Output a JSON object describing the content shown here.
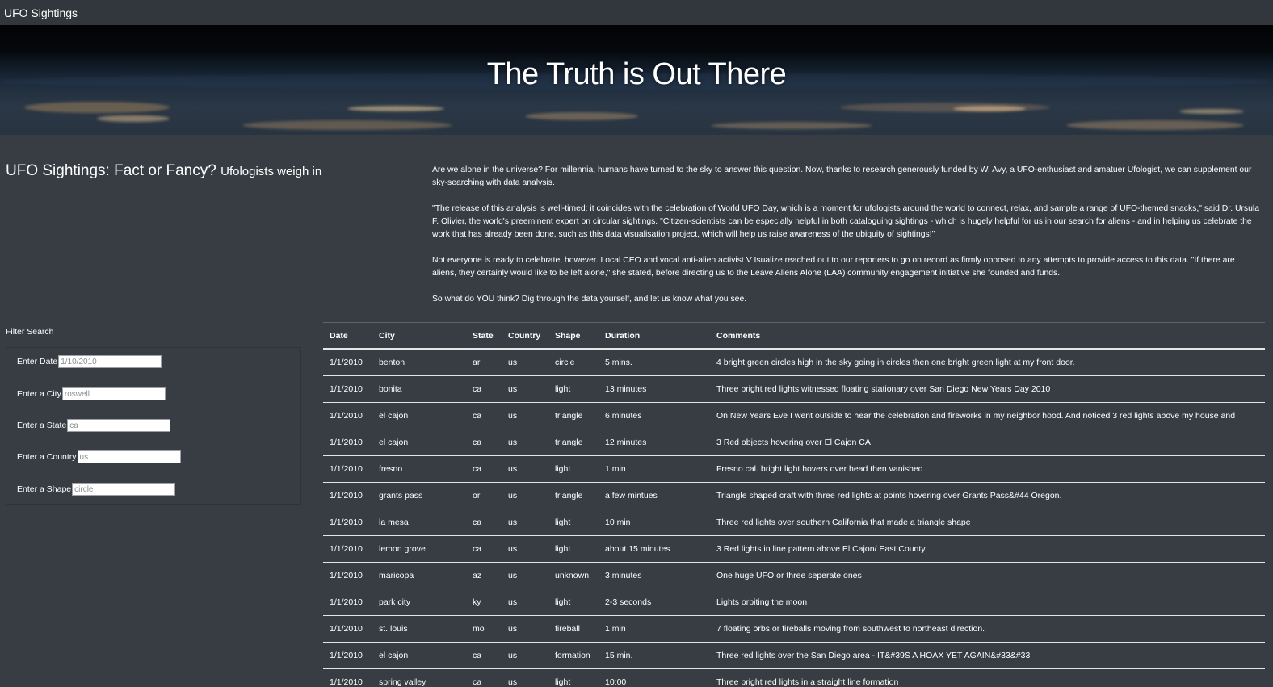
{
  "navbar": {
    "brand": "UFO Sightings"
  },
  "hero": {
    "title": "The Truth is Out There"
  },
  "intro": {
    "heading": "UFO Sightings: Fact or Fancy?",
    "subheading": "Ufologists weigh in",
    "paragraphs": [
      "Are we alone in the universe? For millennia, humans have turned to the sky to answer this question. Now, thanks to research generously funded by W. Avy, a UFO-enthusiast and amatuer Ufologist, we can supplement our sky-searching with data analysis.",
      "\"The release of this analysis is well-timed: it coincides with the celebration of World UFO Day, which is a moment for ufologists around the world to connect, relax, and sample a range of UFO-themed snacks,\" said Dr. Ursula F. Olivier, the world's preeminent expert on circular sightings. \"Citizen-scientists can be especially helpful in both cataloguing sightings - which is hugely helpful for us in our search for aliens - and in helping us celebrate the work that has already been done, such as this data visualisation project, which will help us raise awareness of the ubiquity of sightings!\"",
      "Not everyone is ready to celebrate, however. Local CEO and vocal anti-alien activist V Isualize reached out to our reporters to go on record as firmly opposed to any attempts to provide access to this data. \"If there are aliens, they certainly would like to be left alone,\" she stated, before directing us to the Leave Aliens Alone (LAA) community engagement initiative she founded and funds.",
      "So what do YOU think? Dig through the data yourself, and let us know what you see."
    ]
  },
  "filters": {
    "title": "Filter Search",
    "date": {
      "label": "Enter Date",
      "placeholder": "1/10/2010"
    },
    "city": {
      "label": "Enter a City",
      "placeholder": "roswell"
    },
    "state": {
      "label": "Enter a State",
      "placeholder": "ca"
    },
    "country": {
      "label": "Enter a Country",
      "placeholder": "us"
    },
    "shape": {
      "label": "Enter a Shape",
      "placeholder": "circle"
    }
  },
  "table": {
    "headers": [
      "Date",
      "City",
      "State",
      "Country",
      "Shape",
      "Duration",
      "Comments"
    ],
    "rows": [
      [
        "1/1/2010",
        "benton",
        "ar",
        "us",
        "circle",
        "5 mins.",
        "4 bright green circles high in the sky going in circles then one bright green light at my front door."
      ],
      [
        "1/1/2010",
        "bonita",
        "ca",
        "us",
        "light",
        "13 minutes",
        "Three bright red lights witnessed floating stationary over San Diego New Years Day 2010"
      ],
      [
        "1/1/2010",
        "el cajon",
        "ca",
        "us",
        "triangle",
        "6 minutes",
        "On New Years Eve I went outside to hear the celebration and fireworks in my neighbor hood. And noticed 3 red lights above my house and"
      ],
      [
        "1/1/2010",
        "el cajon",
        "ca",
        "us",
        "triangle",
        "12 minutes",
        "3 Red objects hovering over El Cajon CA"
      ],
      [
        "1/1/2010",
        "fresno",
        "ca",
        "us",
        "light",
        "1 min",
        "Fresno cal. bright light hovers over head then vanished"
      ],
      [
        "1/1/2010",
        "grants pass",
        "or",
        "us",
        "triangle",
        "a few mintues",
        "Triangle shaped craft with three red lights at points hovering over Grants Pass&#44 Oregon."
      ],
      [
        "1/1/2010",
        "la mesa",
        "ca",
        "us",
        "light",
        "10 min",
        "Three red lights over southern California that made a triangle shape"
      ],
      [
        "1/1/2010",
        "lemon grove",
        "ca",
        "us",
        "light",
        "about 15 minutes",
        "3 Red lights in line pattern above El Cajon/ East County."
      ],
      [
        "1/1/2010",
        "maricopa",
        "az",
        "us",
        "unknown",
        "3 minutes",
        "One huge UFO or three seperate ones"
      ],
      [
        "1/1/2010",
        "park city",
        "ky",
        "us",
        "light",
        "2-3 seconds",
        "Lights orbiting the moon"
      ],
      [
        "1/1/2010",
        "st. louis",
        "mo",
        "us",
        "fireball",
        "1 min",
        "7 floating orbs or fireballs moving from southwest to northeast direction."
      ],
      [
        "1/1/2010",
        "el cajon",
        "ca",
        "us",
        "formation",
        "15 min.",
        "Three red lights over the San Diego area - IT&#39S A HOAX YET AGAIN&#33&#33"
      ],
      [
        "1/1/2010",
        "spring valley",
        "ca",
        "us",
        "light",
        "10:00",
        "Three bright red lights in a straight line formation"
      ]
    ]
  }
}
